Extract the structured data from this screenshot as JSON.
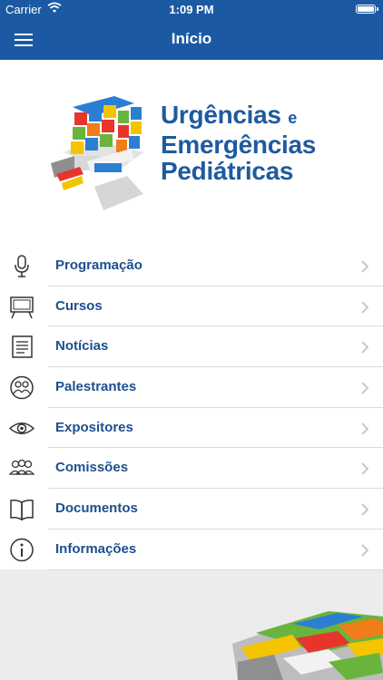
{
  "status_bar": {
    "carrier": "Carrier",
    "time": "1:09 PM"
  },
  "nav": {
    "title": "Início",
    "menu_icon": "hamburger-icon"
  },
  "logo": {
    "line1": "Urgências",
    "line1_suffix": "e",
    "line2": "Emergências",
    "line3": "Pediátricas"
  },
  "menu": {
    "items": [
      {
        "label": "Programação",
        "icon": "microphone-icon"
      },
      {
        "label": "Cursos",
        "icon": "presentation-board-icon"
      },
      {
        "label": "Notícias",
        "icon": "news-icon"
      },
      {
        "label": "Palestrantes",
        "icon": "speakers-icon"
      },
      {
        "label": "Expositores",
        "icon": "eye-icon"
      },
      {
        "label": "Comissões",
        "icon": "group-icon"
      },
      {
        "label": "Documentos",
        "icon": "book-icon"
      },
      {
        "label": "Informações",
        "icon": "info-icon"
      }
    ]
  },
  "colors": {
    "brand": "#1b5aa3",
    "label": "#1d4f8e",
    "logo_text": "#1f5a9f"
  }
}
